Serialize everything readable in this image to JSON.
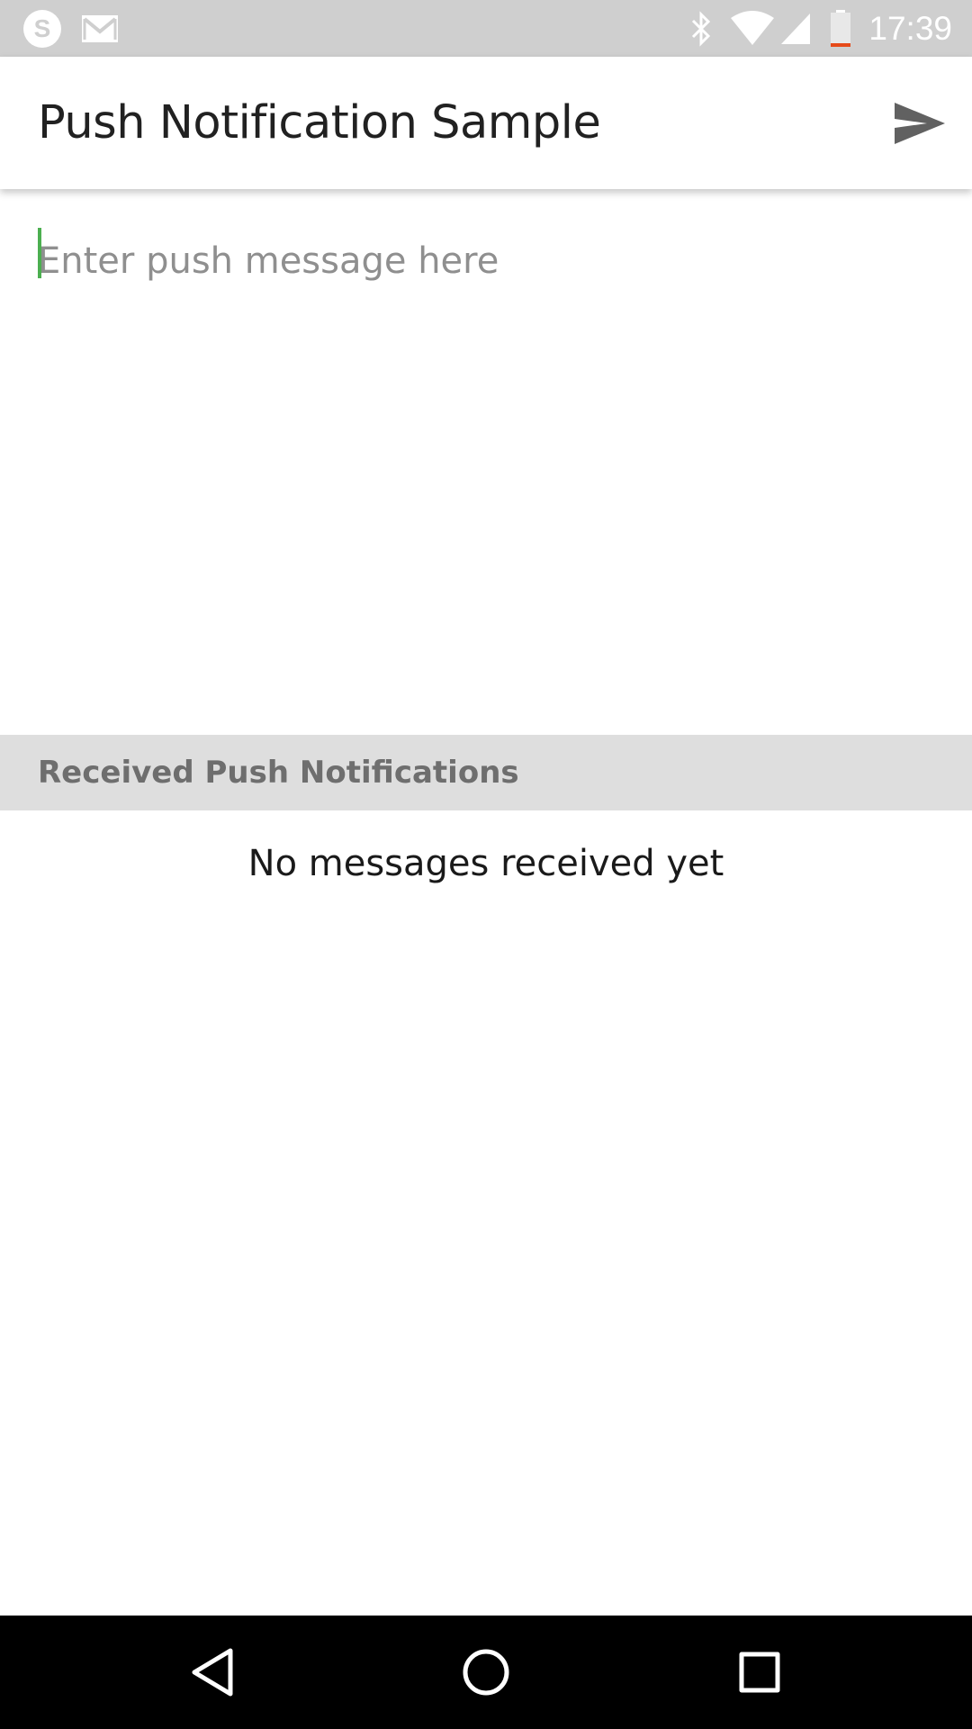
{
  "status_bar": {
    "time": "17:39",
    "left_icons": [
      "skype-icon",
      "gmail-icon"
    ],
    "right_icons": [
      "bluetooth-icon",
      "wifi-icon",
      "signal-icon",
      "battery-icon"
    ],
    "battery_accent": "#e64a19"
  },
  "app_bar": {
    "title": "Push Notification Sample",
    "action_icon": "send-icon"
  },
  "compose": {
    "placeholder": "Enter push message here",
    "value": "",
    "cursor_color": "#4caf50"
  },
  "received": {
    "header": "Received Push Notifications",
    "empty_text": "No messages received yet"
  },
  "nav_bar": {
    "buttons": [
      "back-icon",
      "home-icon",
      "recents-icon"
    ]
  }
}
